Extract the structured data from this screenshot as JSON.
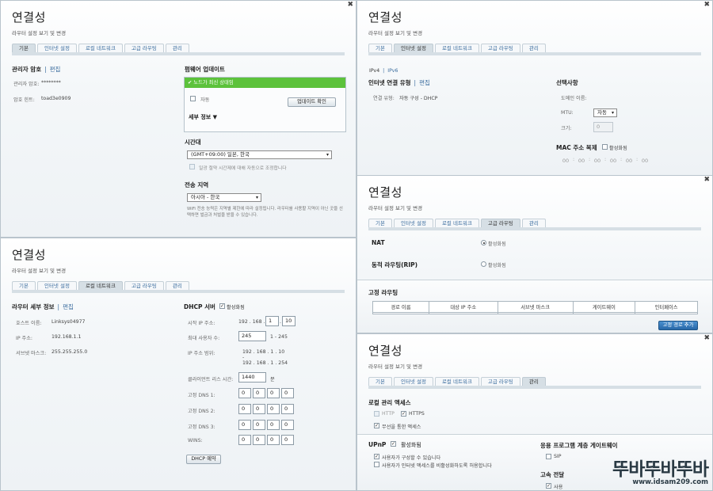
{
  "common": {
    "title": "연결성",
    "subtitle": "라우터 설정 보기 및 변경",
    "tabs": [
      "기본",
      "인터넷 설정",
      "로컬 네트워크",
      "고급 라우팅",
      "관리"
    ],
    "close_icon": "close-icon"
  },
  "basic": {
    "admin_password_heading": "관리자 암호",
    "edit_link": "편집",
    "router_password_label": "관리자 암호:",
    "router_password_value": "********",
    "password_hint_label": "암호 힌트:",
    "password_hint_value": "toad3e0909",
    "firmware_heading": "펌웨어 업데이트",
    "firmware_status": "노드가 최신 상태임",
    "auto_label": "자동",
    "check_update_button": "업데이트 확인",
    "details_label": "세부 정보",
    "timezone_heading": "시간대",
    "timezone_value": "(GMT+09:00) 일본, 한국",
    "dst_label": "일광 절약 시간제에 대해 자동으로 조정합니다",
    "region_heading": "전송 지역",
    "region_value": "아시아 - 한국",
    "region_note": "WiFi 전송 능력은 지역별 제한에 따라 설정됩니다. 라우터를 사용할 지역이 아닌 곳을 선택하면 벌금과 처벌을 받을 수 있습니다."
  },
  "internet": {
    "ipv4_tab": "IPv4",
    "ipv6_tab": "IPv6",
    "connection_type_heading": "인터넷 연결 유형",
    "edit_link": "편집",
    "connection_type_label": "연결 유형:",
    "connection_type_value": "자동 구성 - DHCP",
    "optional_heading": "선택사항",
    "domain_label": "도메인 이름:",
    "mtu_label": "MTU:",
    "mtu_value": "자동",
    "size_label": "크기:",
    "size_value": "0",
    "mac_clone_heading": "MAC 주소 복제",
    "mac_enable_label": "활성화됨",
    "mac_octets": [
      "00",
      "00",
      "00",
      "00",
      "00",
      "00"
    ]
  },
  "advanced": {
    "nat_label": "NAT",
    "nat_enabled_label": "활성화됨",
    "rip_label": "동적 라우팅(RIP)",
    "rip_enabled_label": "활성화됨",
    "static_route_heading": "고정 라우팅",
    "columns": [
      "경로 이름",
      "대상 IP 주소",
      "서브넷 마스크",
      "게이트웨이",
      "인터페이스"
    ],
    "add_route_button": "고정 경로 추가"
  },
  "local": {
    "router_details_heading": "라우터 세부 정보",
    "edit_link": "편집",
    "hostname_label": "호스트 이름:",
    "hostname_value": "Linksys04977",
    "ip_label": "IP 주소:",
    "ip_value": "192.168.1.1",
    "subnet_label": "서브넷 마스크:",
    "subnet_value": "255.255.255.0",
    "dhcp_heading": "DHCP 서버",
    "dhcp_enabled_label": "활성화됨",
    "start_ip_label": "시작 IP 주소:",
    "start_ip_prefix": "192 . 168 .",
    "start_ip_o3": "1",
    "start_ip_o4": "10",
    "max_users_label": "최대 사용자 수:",
    "max_users_value": "245",
    "max_users_range": "1 - 245",
    "ip_range_label": "IP 주소 범위:",
    "ip_range_start": "192 . 168 . 1 . 10",
    "ip_range_dash": "-",
    "ip_range_end": "192 . 168 . 1 . 254",
    "lease_label": "클라이언트 리스 시간:",
    "lease_value": "1440",
    "lease_unit": "분",
    "dns1_label": "고정 DNS 1:",
    "dns2_label": "고정 DNS 2:",
    "dns3_label": "고정 DNS 3:",
    "wins_label": "WINS:",
    "zero": "0",
    "dhcp_reservation_button": "DHCP 예약"
  },
  "admin": {
    "local_access_heading": "로컬 관리 액세스",
    "http_label": "HTTP",
    "https_label": "HTTPS",
    "wireless_access_label": "무선을 통한 액세스",
    "upnp_heading": "UPnP",
    "upnp_enabled_label": "활성화됨",
    "upnp_user_config_label": "사용자가 구성할 수 있습니다",
    "upnp_disable_internet_label": "사용자가 인터넷 액세스를 비활성화하도록 허용합니다",
    "alg_heading": "응용 프로그램 계층 게이트웨이",
    "sip_label": "SIP",
    "express_heading": "고속 전달",
    "express_label": "사용"
  },
  "watermark": {
    "logo_text": "뚜바뚜바뚜바",
    "url": "www.idsam209.com"
  },
  "colors": {
    "link": "#3a6c9e",
    "success_banner": "#5cc23b",
    "primary_button": "#2868a8"
  }
}
